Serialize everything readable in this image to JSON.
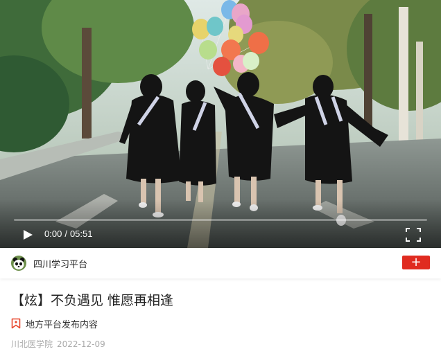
{
  "player": {
    "current_time": "0:00",
    "separator": "/",
    "duration": "05:51",
    "progress": 0,
    "icons": {
      "play": "play-icon",
      "fullscreen": "fullscreen-icon"
    }
  },
  "channel": {
    "name": "四川学习平台",
    "avatar_icon": "panda-avatar-icon",
    "follow_label": "+",
    "follow_color": "#e02b20"
  },
  "article": {
    "title": "【炫】不负遇见 惟愿再相逢",
    "source_label": "地方平台发布内容",
    "source_icon": "bookmark-icon",
    "accent_color": "#e8472d",
    "author": "川北医学院",
    "date": "2022-12-09"
  }
}
